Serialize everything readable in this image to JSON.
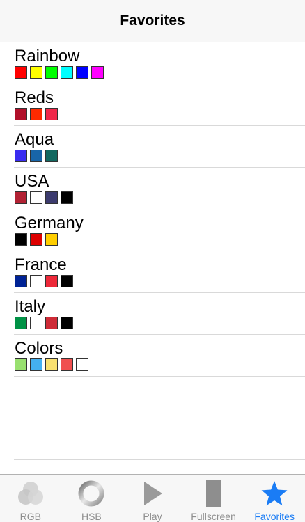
{
  "navbar": {
    "title": "Favorites"
  },
  "favorites": [
    {
      "name": "Rainbow",
      "colors": [
        "#ff0000",
        "#ffff00",
        "#00ff00",
        "#00ffff",
        "#0000ff",
        "#ff00ff"
      ]
    },
    {
      "name": "Reds",
      "colors": [
        "#b0102a",
        "#ff2a00",
        "#f0284a"
      ]
    },
    {
      "name": "Aqua",
      "colors": [
        "#3a2cf0",
        "#1865a8",
        "#126860"
      ]
    },
    {
      "name": "USA",
      "colors": [
        "#b22234",
        "#ffffff",
        "#3c3b6e",
        "#000000"
      ]
    },
    {
      "name": "Germany",
      "colors": [
        "#000000",
        "#dd0000",
        "#ffce00"
      ]
    },
    {
      "name": "France",
      "colors": [
        "#002395",
        "#ffffff",
        "#ed2939",
        "#000000"
      ]
    },
    {
      "name": "Italy",
      "colors": [
        "#009246",
        "#ffffff",
        "#ce2b37",
        "#000000"
      ]
    },
    {
      "name": "Colors",
      "colors": [
        "#99e070",
        "#44b0f0",
        "#f8e070",
        "#f05050",
        "#ffffff"
      ]
    }
  ],
  "tabs": [
    {
      "label": "RGB",
      "icon": "rgb-circles-icon"
    },
    {
      "label": "HSB",
      "icon": "hsb-ring-icon"
    },
    {
      "label": "Play",
      "icon": "play-icon"
    },
    {
      "label": "Fullscreen",
      "icon": "fullscreen-icon"
    },
    {
      "label": "Favorites",
      "icon": "star-icon",
      "active": true
    }
  ],
  "accent_color": "#1a7cf5"
}
